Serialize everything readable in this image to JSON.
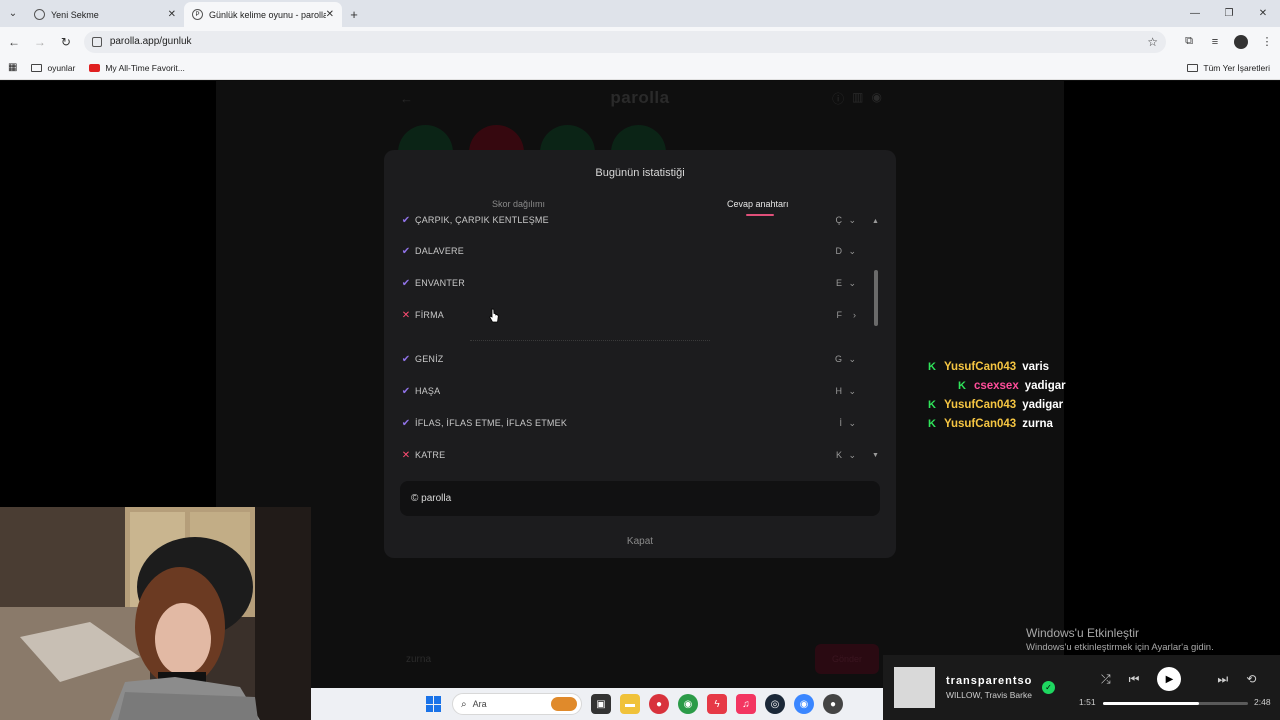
{
  "browser": {
    "tabs": [
      {
        "label": "Yeni Sekme",
        "close": "✕"
      },
      {
        "label": "Günlük kelime oyunu - parolla",
        "close": "✕"
      }
    ],
    "new_tab": "+",
    "url": "parolla.app/gunluk",
    "bookmarks": [
      {
        "label": "oyunlar"
      },
      {
        "label": "My All-Time Favorit..."
      }
    ],
    "all_bookmarks": "Tüm Yer İşaretleri"
  },
  "game": {
    "logo": "parolla",
    "bubble_colors": [
      "#0f2a1a",
      "#3a0a12",
      "#0f2a1a",
      "#0f2a1a"
    ]
  },
  "modal": {
    "title": "Bugünün istatistiği",
    "tab_score": "Skor dağılımı",
    "tab_answers": "Cevap anahtarı",
    "rows": [
      {
        "status": "correct",
        "word": "ÇARPIK, ÇARPIK KENTLEŞME",
        "letter": "Ç",
        "expanded": false
      },
      {
        "status": "correct",
        "word": "DALAVERE",
        "letter": "D",
        "expanded": false
      },
      {
        "status": "correct",
        "word": "ENVANTER",
        "letter": "E",
        "expanded": false
      },
      {
        "status": "wrong",
        "word": "FİRMA",
        "letter": "F",
        "expanded": true
      },
      {
        "status": "correct",
        "word": "GENİZ",
        "letter": "G",
        "expanded": false
      },
      {
        "status": "correct",
        "word": "HAŞA",
        "letter": "H",
        "expanded": false
      },
      {
        "status": "correct",
        "word": "İFLAS, İFLAS ETME, İFLAS ETMEK",
        "letter": "İ",
        "expanded": false
      },
      {
        "status": "wrong",
        "word": "KATRE",
        "letter": "K",
        "expanded": false
      }
    ],
    "footer": "© parolla",
    "close_label": "Kapat"
  },
  "page_ghost": {
    "input_value": "zurna",
    "submit_label": "Gönder"
  },
  "chat": [
    {
      "user": "YusufCan043",
      "user_color": "#f5c542",
      "message": "varis",
      "indent": false
    },
    {
      "user": "csexsex",
      "user_color": "#ff4d9a",
      "message": "yadigar",
      "indent": true
    },
    {
      "user": "YusufCan043",
      "user_color": "#f5c542",
      "message": "yadigar",
      "indent": false
    },
    {
      "user": "YusufCan043",
      "user_color": "#f5c542",
      "message": "zurna",
      "indent": false
    }
  ],
  "windows_activation": {
    "title": "Windows'u Etkinleştir",
    "subtitle": "Windows'u etkinleştirmek için Ayarlar'a gidin."
  },
  "taskbar": {
    "search_placeholder": "Ara"
  },
  "media": {
    "title": "transparentsoul",
    "artist": "WILLOW, Travis Barker",
    "elapsed": "1:51",
    "duration": "2:48",
    "progress": 0.66
  }
}
